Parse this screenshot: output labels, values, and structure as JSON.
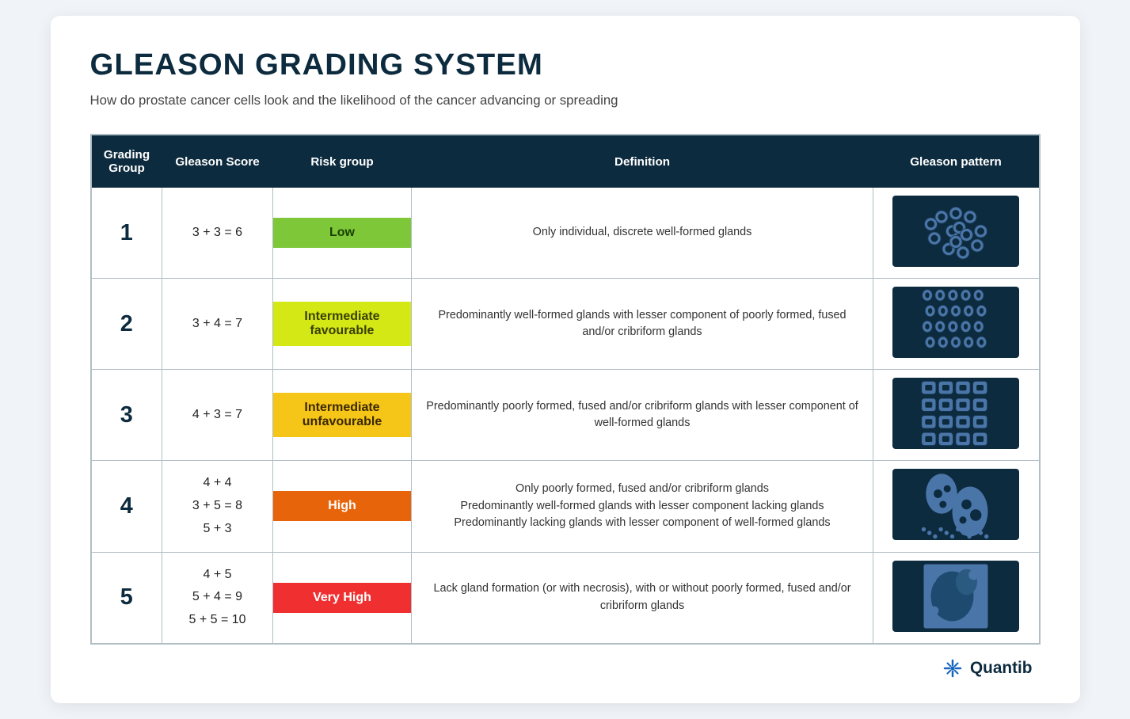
{
  "title": "GLEASON GRADING SYSTEM",
  "subtitle": "How do prostate cancer cells look and the likelihood of the cancer advancing or spreading",
  "table": {
    "headers": {
      "grading": "Grading Group",
      "score": "Gleason Score",
      "risk": "Risk group",
      "definition": "Definition",
      "pattern": "Gleason pattern"
    },
    "rows": [
      {
        "group": "1",
        "score": "3 + 3 = 6",
        "risk": "Low",
        "risk_class": "risk-low",
        "definition": "Only individual, discrete well-formed glands",
        "pattern_type": "pattern1"
      },
      {
        "group": "2",
        "score": "3 + 4 = 7",
        "risk": "Intermediate favourable",
        "risk_class": "risk-int-fav",
        "definition": "Predominantly well-formed glands with lesser component of poorly formed, fused and/or cribriform glands",
        "pattern_type": "pattern2"
      },
      {
        "group": "3",
        "score": "4 + 3 = 7",
        "risk": "Intermediate unfavourable",
        "risk_class": "risk-int-unfav",
        "definition": "Predominantly poorly formed, fused and/or cribriform glands with lesser component of well-formed glands",
        "pattern_type": "pattern3"
      },
      {
        "group": "4",
        "score": "4 + 4\n3 + 5 = 8\n5 + 3",
        "risk": "High",
        "risk_class": "risk-high",
        "definition": "Only poorly formed, fused and/or cribriform glands\nPredominantly well-formed glands with lesser component lacking glands\nPredominantly lacking glands with lesser component of well-formed glands",
        "pattern_type": "pattern4"
      },
      {
        "group": "5",
        "score": "4 + 5\n5 + 4 = 9\n5 + 5 = 10",
        "risk": "Very High",
        "risk_class": "risk-very-high",
        "definition": "Lack gland formation (or with necrosis), with or without poorly formed, fused and/or cribriform glands",
        "pattern_type": "pattern5"
      }
    ]
  },
  "brand": {
    "name": "Quantib"
  }
}
